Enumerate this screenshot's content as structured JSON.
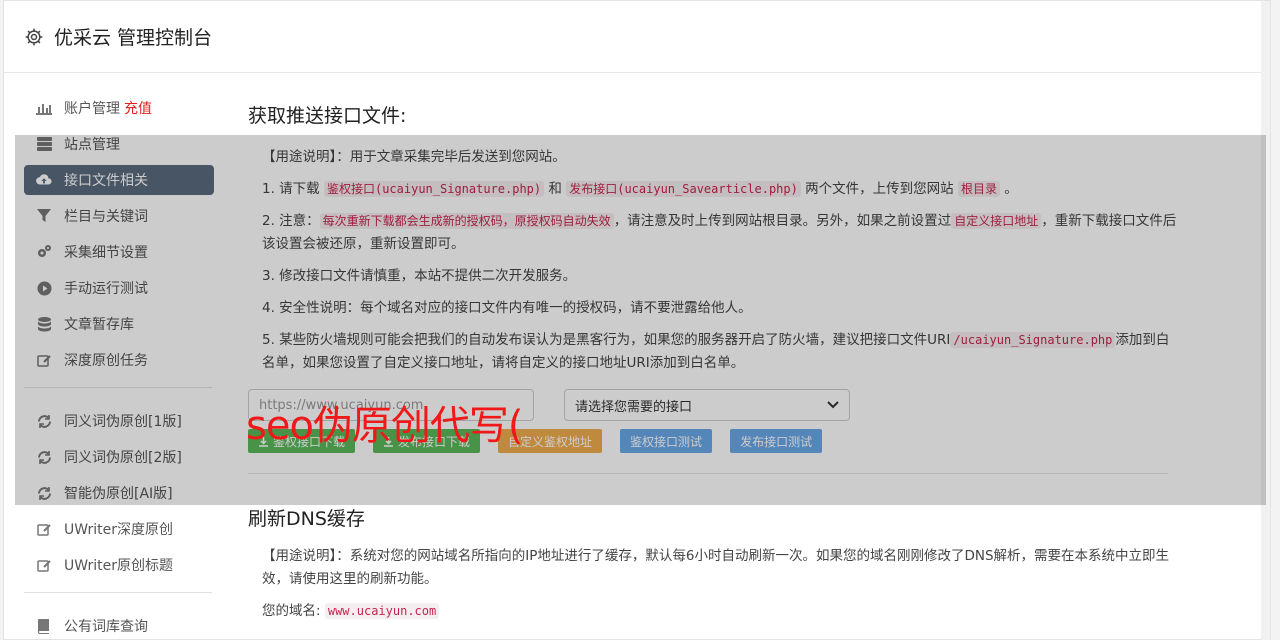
{
  "header": {
    "title": "优采云 管理控制台",
    "icon": "gear-icon"
  },
  "sidebar": {
    "items": [
      {
        "label": "账户管理",
        "extra": "充值",
        "icon": "bar-chart-icon"
      },
      {
        "label": "站点管理",
        "icon": "server-icon"
      },
      {
        "label": "接口文件相关",
        "icon": "cloud-upload-icon",
        "active": true
      },
      {
        "label": "栏目与关键词",
        "icon": "filter-icon"
      },
      {
        "label": "采集细节设置",
        "icon": "gears-icon"
      },
      {
        "label": "手动运行测试",
        "icon": "play-circle-icon"
      },
      {
        "label": "文章暂存库",
        "icon": "database-icon"
      },
      {
        "label": "深度原创任务",
        "icon": "edit-icon"
      }
    ],
    "items2": [
      {
        "label": "同义词伪原创[1版]",
        "icon": "refresh-icon"
      },
      {
        "label": "同义词伪原创[2版]",
        "icon": "refresh-icon"
      },
      {
        "label": "智能伪原创[AI版]",
        "icon": "refresh-icon"
      },
      {
        "label": "UWriter深度原创",
        "icon": "edit-icon"
      },
      {
        "label": "UWriter原创标题",
        "icon": "edit-icon"
      }
    ],
    "items3": [
      {
        "label": "公有词库查询",
        "icon": "book-icon"
      }
    ]
  },
  "section1": {
    "title": "获取推送接口文件:",
    "usage": "【用途说明】：用于文章采集完毕后发送到您网站。",
    "step1": {
      "a": "1. 请下载 ",
      "code1": "鉴权接口(ucaiyun_Signature.php)",
      "b": " 和 ",
      "code2": "发布接口(ucaiyun_Savearticle.php)",
      "c": " 两个文件，上传到您网站 ",
      "code3": "根目录",
      "d": " 。"
    },
    "step2": {
      "a": "2. 注意：",
      "code1": "每次重新下载都会生成新的授权码，原授权码自动失效",
      "b": "，请注意及时上传到网站根目录。另外，如果之前设置过",
      "code2": "自定义接口地址",
      "c": "，重新下载接口文件后该设置会被还原，重新设置即可。"
    },
    "step3": "3. 修改接口文件请慎重，本站不提供二次开发服务。",
    "step4": "4. 安全性说明：每个域名对应的接口文件内有唯一的授权码，请不要泄露给他人。",
    "step5": {
      "a": "5. 某些防火墙规则可能会把我们的自动发布误认为是黑客行为，如果您的服务器开启了防火墙，建议把接口文件URI",
      "code1": "/ucaiyun_Signature.php",
      "b": "添加到白名单，如果您设置了自定义接口地址，请将自定义的接口地址URI添加到白名单。"
    },
    "input_placeholder": "https://www.ucaiyun.com",
    "select_value": "请选择您需要的接口",
    "buttons": {
      "auth_download": "鉴权接口下载",
      "publish_download": "发布接口下载",
      "custom_auth": "自定义鉴权地址",
      "auth_test": "鉴权接口测试",
      "publish_test": "发布接口测试"
    }
  },
  "section2": {
    "title": "刷新DNS缓存",
    "usage": "【用途说明】：系统对您的网站域名所指向的IP地址进行了缓存，默认每6小时自动刷新一次。如果您的域名刚刚修改了DNS解析，需要在本系统中立即生效，请使用这里的刷新功能。",
    "domain_label": "您的域名:",
    "domain_value": "www.ucaiyun.com"
  },
  "watermark": "seo伪原创代写(",
  "colors": {
    "active_nav": "#5a6b7f",
    "recharge": "#e02020",
    "code": "#c7254e",
    "btn_green": "#5cb85c",
    "btn_orange": "#f0ad4e",
    "btn_blue": "#6aa8e8",
    "watermark": "#f01818"
  }
}
